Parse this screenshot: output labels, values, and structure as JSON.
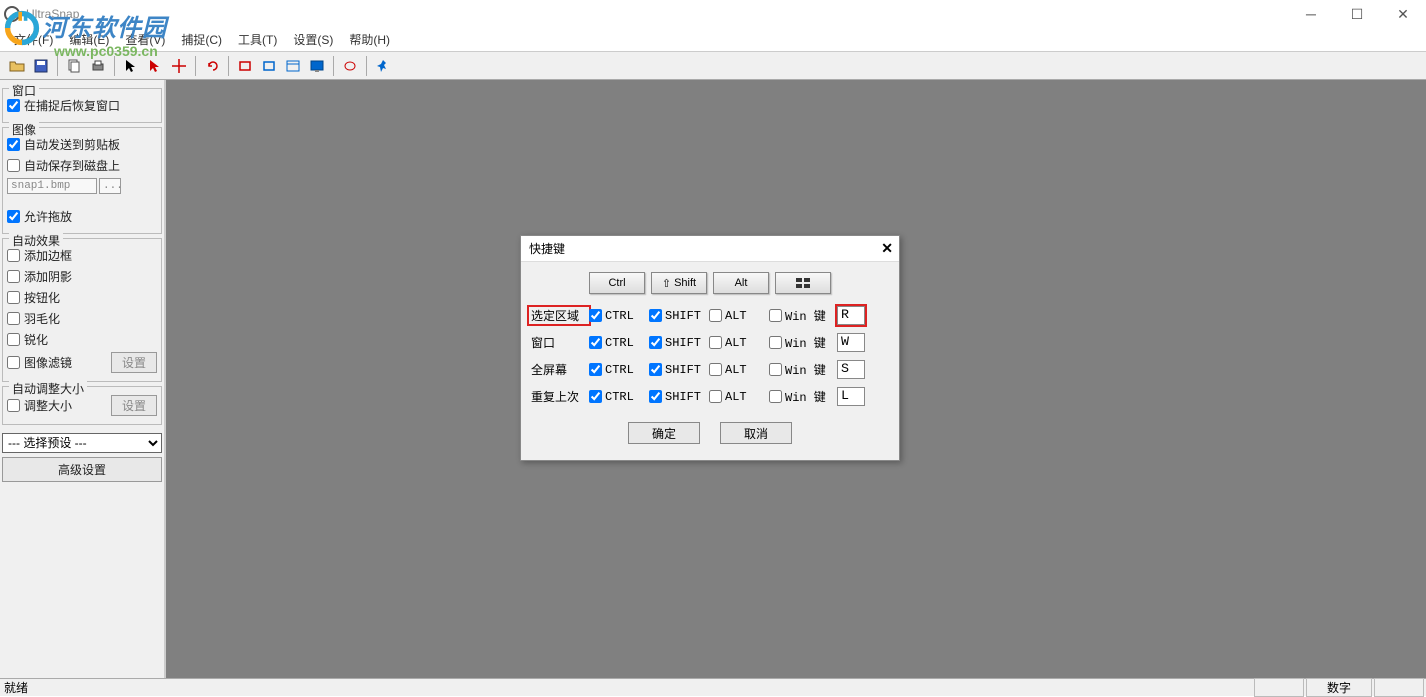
{
  "app_title": "UltraSnap",
  "watermark": {
    "text": "河东软件园",
    "url": "www.pc0359.cn"
  },
  "menu": {
    "file": "文件(F)",
    "edit": "编辑(E)",
    "view": "查看(V)",
    "capture": "捕捉(C)",
    "tools": "工具(T)",
    "settings": "设置(S)",
    "help": "帮助(H)"
  },
  "panel": {
    "window_group": "窗口",
    "restore_window": "在捕捉后恢复窗口",
    "image_group": "图像",
    "auto_clipboard": "自动发送到剪贴板",
    "auto_save_disk": "自动保存到磁盘上",
    "filename": "snap1.bmp",
    "dots": "...",
    "allow_drag": "允许拖放",
    "effects_group": "自动效果",
    "add_border": "添加边框",
    "add_shadow": "添加阴影",
    "buttonize": "按钮化",
    "feather": "羽毛化",
    "sharpen": "锐化",
    "image_filter": "图像滤镜",
    "settings_btn": "设置",
    "resize_group": "自动调整大小",
    "resize": "调整大小",
    "preset_placeholder": "--- 选择预设 ---",
    "advanced_btn": "高级设置"
  },
  "dialog": {
    "title": "快捷键",
    "mod_ctrl": "Ctrl",
    "mod_shift": "Shift",
    "mod_alt": "Alt",
    "ctrl_label": "CTRL",
    "shift_label": "SHIFT",
    "alt_label": "ALT",
    "win_label": "Win 键",
    "rows": [
      {
        "label": "选定区域",
        "ctrl": true,
        "shift": true,
        "alt": false,
        "win": false,
        "key": "R",
        "highlight": true
      },
      {
        "label": "窗口",
        "ctrl": true,
        "shift": true,
        "alt": false,
        "win": false,
        "key": "W",
        "highlight": false
      },
      {
        "label": "全屏幕",
        "ctrl": true,
        "shift": true,
        "alt": false,
        "win": false,
        "key": "S",
        "highlight": false
      },
      {
        "label": "重复上次",
        "ctrl": true,
        "shift": true,
        "alt": false,
        "win": false,
        "key": "L",
        "highlight": false
      }
    ],
    "ok": "确定",
    "cancel": "取消"
  },
  "status": {
    "ready": "就绪",
    "num": "数字"
  }
}
